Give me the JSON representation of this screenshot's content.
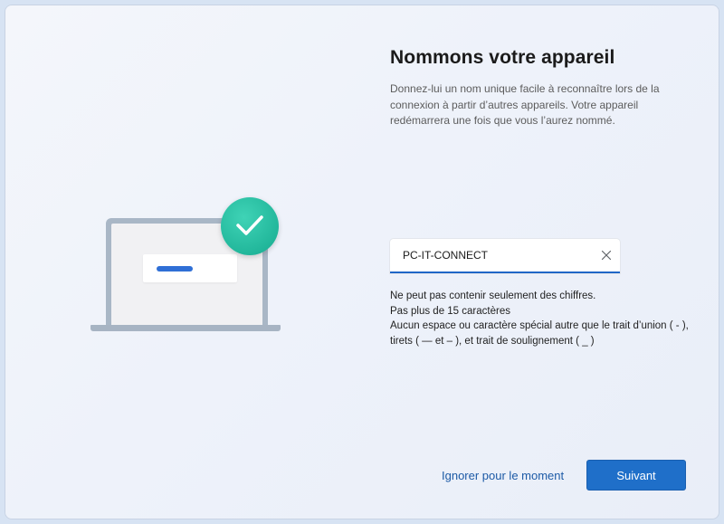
{
  "page": {
    "title": "Nommons votre appareil",
    "description": "Donnez-lui un nom unique facile à reconnaître lors de la connexion à partir d’autres appareils. Votre appareil redémarrera une fois que vous l’aurez nommé."
  },
  "name_field": {
    "value": "PC-IT-CONNECT",
    "clear_icon": "close-icon"
  },
  "rules": [
    "Ne peut pas contenir seulement des chiffres.",
    "Pas plus de 15 caractères",
    "Aucun espace ou caractère spécial autre que le trait d’union ( - ), tirets ( — et – ), et trait de soulignement ( _ )"
  ],
  "actions": {
    "skip_label": "Ignorer pour le moment",
    "next_label": "Suivant"
  },
  "illustration": {
    "icons": [
      "laptop-icon",
      "checkmark-icon"
    ],
    "accent_color": "#22b79b",
    "bar_color": "#2f6fd6"
  },
  "colors": {
    "primary_button": "#1f6fc9",
    "link": "#1c5aa6",
    "input_underline": "#1f67c7"
  }
}
